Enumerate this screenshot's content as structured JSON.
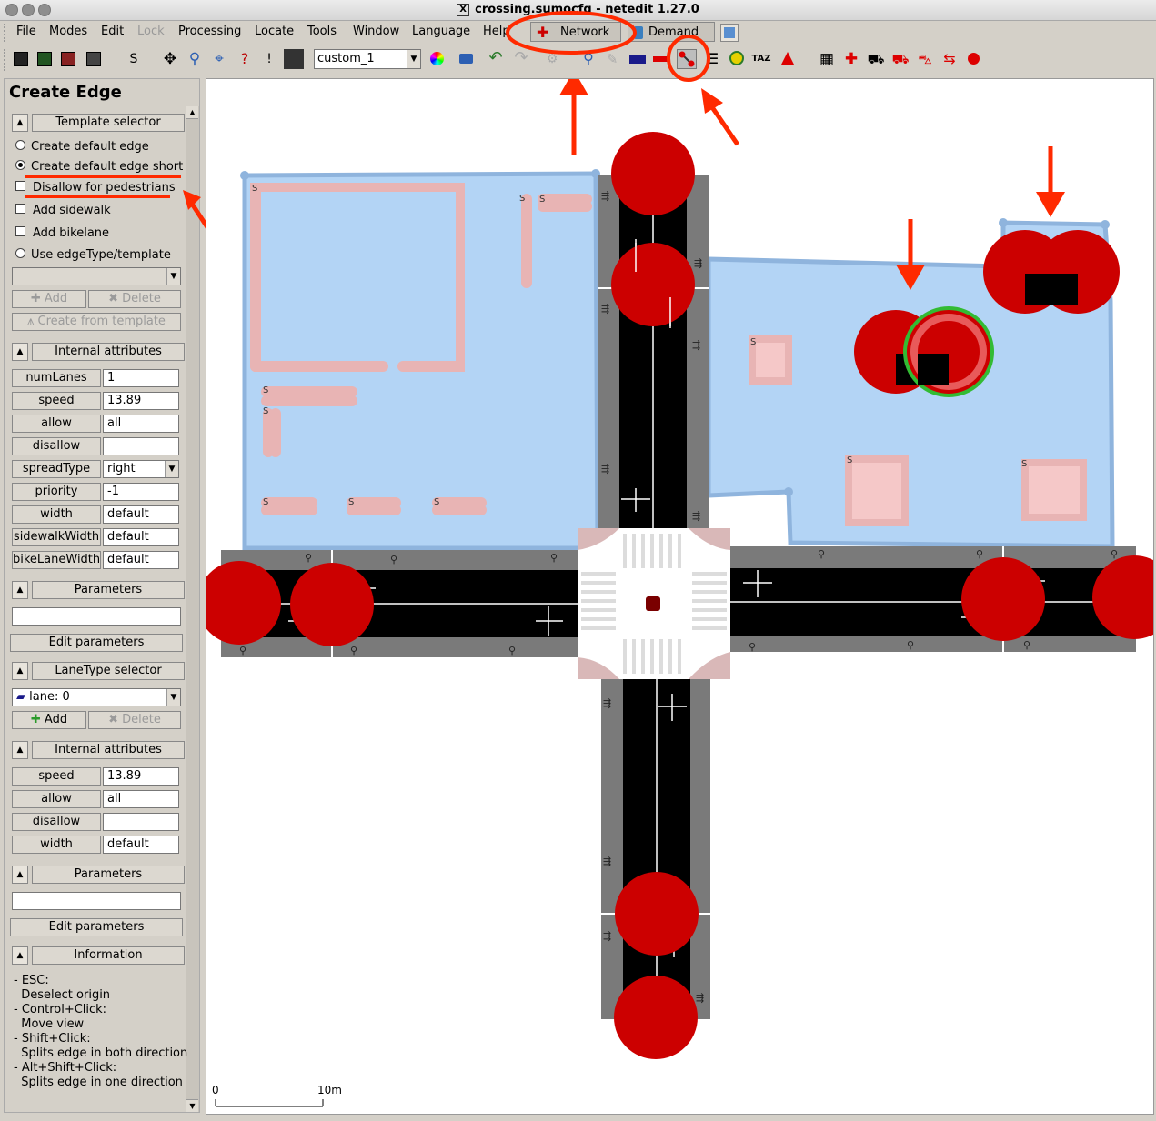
{
  "window": {
    "title": "crossing.sumocfg - netedit 1.27.0"
  },
  "menu": [
    "File",
    "Modes",
    "Edit",
    "Lock",
    "Processing",
    "Locate",
    "Tools",
    "Window",
    "Language",
    "Help"
  ],
  "supermodes": {
    "network": "Network",
    "demand": "Demand"
  },
  "toolbar": {
    "s_label": "S",
    "view_combo": "custom_1"
  },
  "sidebar": {
    "title": "Create Edge",
    "template_selector": {
      "header": "Template selector",
      "options": [
        "Create default edge",
        "Create default edge short"
      ],
      "checks": [
        "Disallow for pedestrians",
        "Add sidewalk",
        "Add bikelane"
      ],
      "use_template": "Use edgeType/template",
      "add": "Add",
      "delete": "Delete",
      "create_from_template": "Create from template"
    },
    "internal_attributes": {
      "header": "Internal attributes",
      "rows": [
        {
          "label": "numLanes",
          "value": "1"
        },
        {
          "label": "speed",
          "value": "13.89"
        },
        {
          "label": "allow",
          "value": "all"
        },
        {
          "label": "disallow",
          "value": ""
        },
        {
          "label": "spreadType",
          "value": "right"
        },
        {
          "label": "priority",
          "value": "-1"
        },
        {
          "label": "width",
          "value": "default"
        },
        {
          "label": "sidewalkWidth",
          "value": "default"
        },
        {
          "label": "bikeLaneWidth",
          "value": "default"
        }
      ]
    },
    "parameters": {
      "header": "Parameters",
      "edit": "Edit parameters"
    },
    "lanetype_selector": {
      "header": "LaneType selector",
      "combo": "lane: 0",
      "add": "Add",
      "delete": "Delete"
    },
    "lane_internal_attributes": {
      "header": "Internal attributes",
      "rows": [
        {
          "label": "speed",
          "value": "13.89"
        },
        {
          "label": "allow",
          "value": "all"
        },
        {
          "label": "disallow",
          "value": ""
        },
        {
          "label": "width",
          "value": "default"
        }
      ]
    },
    "parameters2": {
      "header": "Parameters",
      "edit": "Edit parameters"
    },
    "information": {
      "header": "Information",
      "lines": [
        "- ESC:",
        "  Deselect origin",
        "- Control+Click:",
        "  Move view",
        "- Shift+Click:",
        "  Splits edge in both direction",
        "- Alt+Shift+Click:",
        "  Splits edge in one direction"
      ]
    }
  },
  "canvas": {
    "scale_start": "0",
    "scale_end": "10m",
    "colors": {
      "polygon": "#b3d4f5",
      "poly_border": "#8fb4dd",
      "road": "#000000",
      "sidewalk": "#7a7a7a",
      "junction_marker": "#cc0000",
      "annotation": "#ff2a00",
      "selected_ring": "#33bb33"
    }
  }
}
